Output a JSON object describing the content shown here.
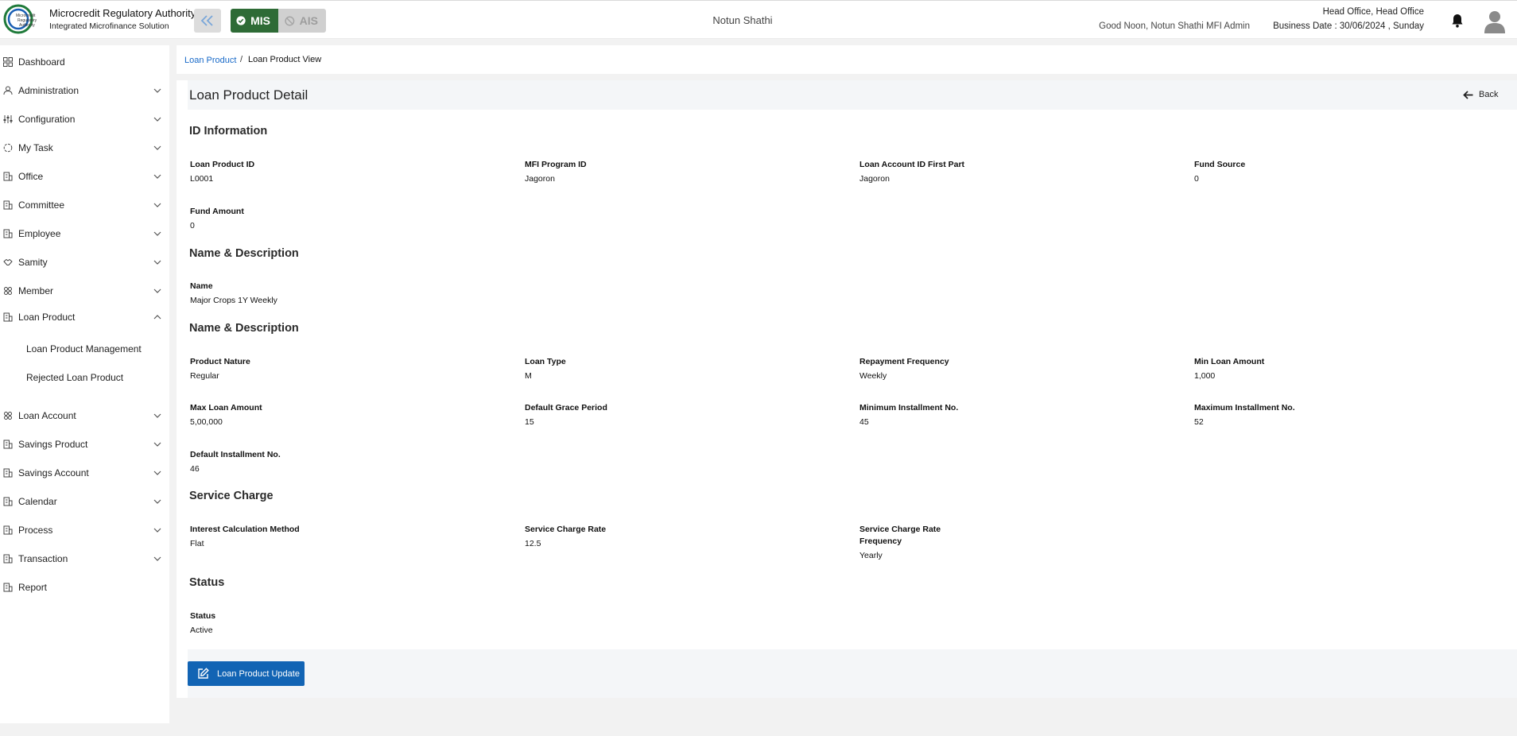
{
  "header": {
    "brand_title": "Microcredit Regulatory Authority",
    "brand_subtitle": "Integrated Microfinance Solution",
    "mode_mis": "MIS",
    "mode_ais": "AIS",
    "org_name": "Notun Shathi",
    "greeting": "Good Noon, Notun Shathi MFI Admin",
    "office": "Head Office, Head Office",
    "business_date": "Business Date : 30/06/2024 , Sunday"
  },
  "sidebar": {
    "items": [
      {
        "label": "Dashboard"
      },
      {
        "label": "Administration"
      },
      {
        "label": "Configuration"
      },
      {
        "label": "My Task"
      },
      {
        "label": "Office"
      },
      {
        "label": "Committee"
      },
      {
        "label": "Employee"
      },
      {
        "label": "Samity"
      },
      {
        "label": "Member"
      },
      {
        "label": "Loan Product"
      },
      {
        "label": "Loan Account"
      },
      {
        "label": "Savings Product"
      },
      {
        "label": "Savings Account"
      },
      {
        "label": "Calendar"
      },
      {
        "label": "Process"
      },
      {
        "label": "Transaction"
      },
      {
        "label": "Report"
      }
    ],
    "loan_product_sub": [
      {
        "label": "Loan Product Management"
      },
      {
        "label": "Rejected Loan Product"
      }
    ]
  },
  "breadcrumb": {
    "parent": "Loan Product",
    "separator": "/",
    "current": "Loan Product View"
  },
  "detail": {
    "title": "Loan Product Detail",
    "back_label": "Back",
    "sections": {
      "id_info": "ID Information",
      "name_desc": "Name & Description",
      "name_desc_2": "Name & Description",
      "service_charge": "Service Charge",
      "status": "Status"
    },
    "fields": {
      "loan_product_id": {
        "label": "Loan Product ID",
        "value": "L0001"
      },
      "mfi_program_id": {
        "label": "MFI Program ID",
        "value": "Jagoron"
      },
      "loan_account_id_first_part": {
        "label": "Loan Account ID First Part",
        "value": "Jagoron"
      },
      "fund_source": {
        "label": "Fund Source",
        "value": "0"
      },
      "fund_amount": {
        "label": "Fund Amount",
        "value": "0"
      },
      "name": {
        "label": "Name",
        "value": "Major Crops 1Y Weekly"
      },
      "product_nature": {
        "label": "Product Nature",
        "value": "Regular"
      },
      "loan_type": {
        "label": "Loan Type",
        "value": "M"
      },
      "repayment_frequency": {
        "label": "Repayment Frequency",
        "value": "Weekly"
      },
      "min_loan_amount": {
        "label": "Min Loan Amount",
        "value": "1,000"
      },
      "max_loan_amount": {
        "label": "Max Loan Amount",
        "value": "5,00,000"
      },
      "default_grace_period": {
        "label": "Default Grace Period",
        "value": "15"
      },
      "minimum_installment_no": {
        "label": "Minimum Installment No.",
        "value": "45"
      },
      "maximum_installment_no": {
        "label": "Maximum Installment No.",
        "value": "52"
      },
      "default_installment_no": {
        "label": "Default Installment No.",
        "value": "46"
      },
      "interest_calculation_method": {
        "label": "Interest Calculation Method",
        "value": "Flat"
      },
      "service_charge_rate": {
        "label": "Service Charge Rate",
        "value": "12.5"
      },
      "service_charge_rate_frequency": {
        "label_line1": "Service Charge Rate",
        "label_line2": "Frequency",
        "value": "Yearly"
      },
      "status": {
        "label": "Status",
        "value": "Active"
      }
    },
    "update_button": "Loan Product Update"
  }
}
